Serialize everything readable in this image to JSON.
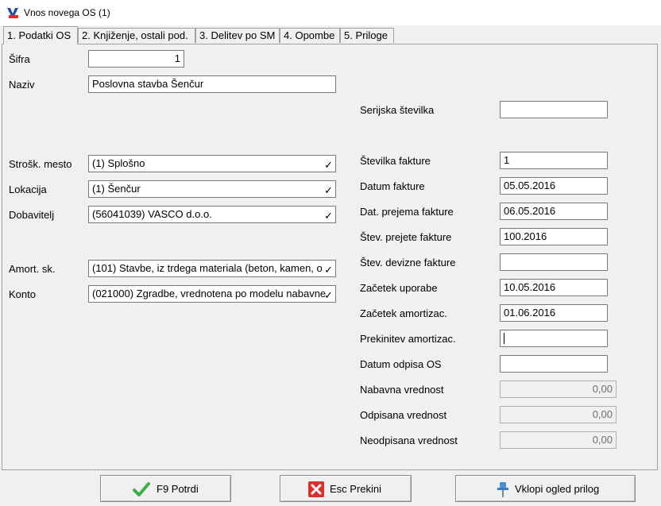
{
  "window": {
    "title": "Vnos novega OS   (1)"
  },
  "tabs": [
    {
      "label": "1. Podatki OS"
    },
    {
      "label": "2. Knjiženje, ostali pod."
    },
    {
      "label": "3. Delitev po SM"
    },
    {
      "label": "4. Opombe"
    },
    {
      "label": "5. Priloge"
    }
  ],
  "left": {
    "sifra": {
      "label": "Šifra",
      "value": "1"
    },
    "naziv": {
      "label": "Naziv",
      "value": "Poslovna stavba Šenčur"
    },
    "strosk": {
      "label": "Strošk. mesto",
      "value": "(1) Splošno"
    },
    "lokacija": {
      "label": "Lokacija",
      "value": "(1) Šenčur"
    },
    "dobavitelj": {
      "label": "Dobavitelj",
      "value": "(56041039) VASCO d.o.o."
    },
    "amort": {
      "label": "Amort. sk.",
      "value": "(101) Stavbe, iz trdega materiala (beton, kamen, o"
    },
    "konto": {
      "label": "Konto",
      "value": "(021000) Zgradbe, vrednotena po modelu nabavne"
    }
  },
  "right": {
    "serijska": {
      "label": "Serijska številka",
      "value": ""
    },
    "st_fakture": {
      "label": "Številka fakture",
      "value": "1"
    },
    "datum_fakture": {
      "label": "Datum fakture",
      "value": "05.05.2016"
    },
    "dat_prejema": {
      "label": "Dat. prejema fakture",
      "value": "06.05.2016"
    },
    "st_prejete": {
      "label": "Štev. prejete fakture",
      "value": "100.2016"
    },
    "st_devizne": {
      "label": "Štev. devizne fakture",
      "value": ""
    },
    "zacetek_uporabe": {
      "label": "Začetek uporabe",
      "value": "10.05.2016"
    },
    "zacetek_amort": {
      "label": "Začetek amortizac.",
      "value": "01.06.2016"
    },
    "prekinitev": {
      "label": "Prekinitev amortizac.",
      "value": ""
    },
    "datum_odpisa": {
      "label": "Datum odpisa OS",
      "value": ""
    },
    "nabavna": {
      "label": "Nabavna vrednost",
      "value": "0,00"
    },
    "odpisana": {
      "label": "Odpisana vrednost",
      "value": "0,00"
    },
    "neodpisana": {
      "label": "Neodpisana vrednost",
      "value": "0,00"
    }
  },
  "buttons": {
    "confirm": {
      "label": "F9 Potrdi",
      "icon": "checkmark-icon",
      "color": "#3cb043"
    },
    "cancel": {
      "label": "Esc Prekini",
      "icon": "close-icon",
      "color": "#d9302c"
    },
    "attachments": {
      "label": "Vklopi ogled prilog",
      "icon": "pushpin-icon",
      "color": "#4a90d9"
    }
  }
}
